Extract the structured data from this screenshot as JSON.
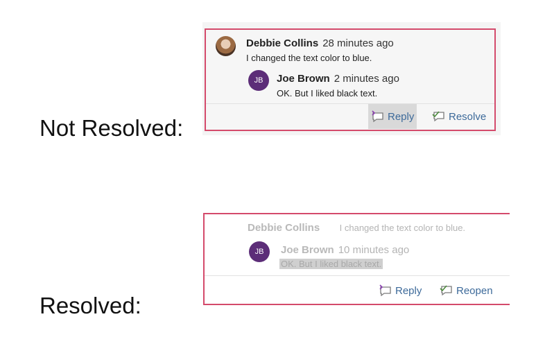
{
  "captions": {
    "not_resolved": "Not Resolved:",
    "resolved": "Resolved:"
  },
  "not_resolved_card": {
    "comment": {
      "author": "Debbie Collins",
      "time": "28 minutes ago",
      "text": "I changed the text color to blue."
    },
    "reply": {
      "initials": "JB",
      "author": "Joe Brown",
      "time": "2 minutes ago",
      "text": "OK.  But I liked black text."
    },
    "actions": {
      "reply_label": "Reply",
      "resolve_label": "Resolve"
    }
  },
  "resolved_card": {
    "comment": {
      "author": "Debbie Collins",
      "text": "I changed the text color to blue."
    },
    "reply": {
      "initials": "JB",
      "author": "Joe Brown",
      "time": "10 minutes ago",
      "text": "OK.  But I liked black text."
    },
    "actions": {
      "reply_label": "Reply",
      "reopen_label": "Reopen"
    }
  },
  "colors": {
    "border_accent": "#d44a6b",
    "avatar_purple": "#5c2d78",
    "action_blue": "#3d6a9a"
  },
  "icons": {
    "reply": "reply-comment-icon",
    "resolve": "resolve-comment-icon",
    "reopen": "reopen-comment-icon"
  }
}
